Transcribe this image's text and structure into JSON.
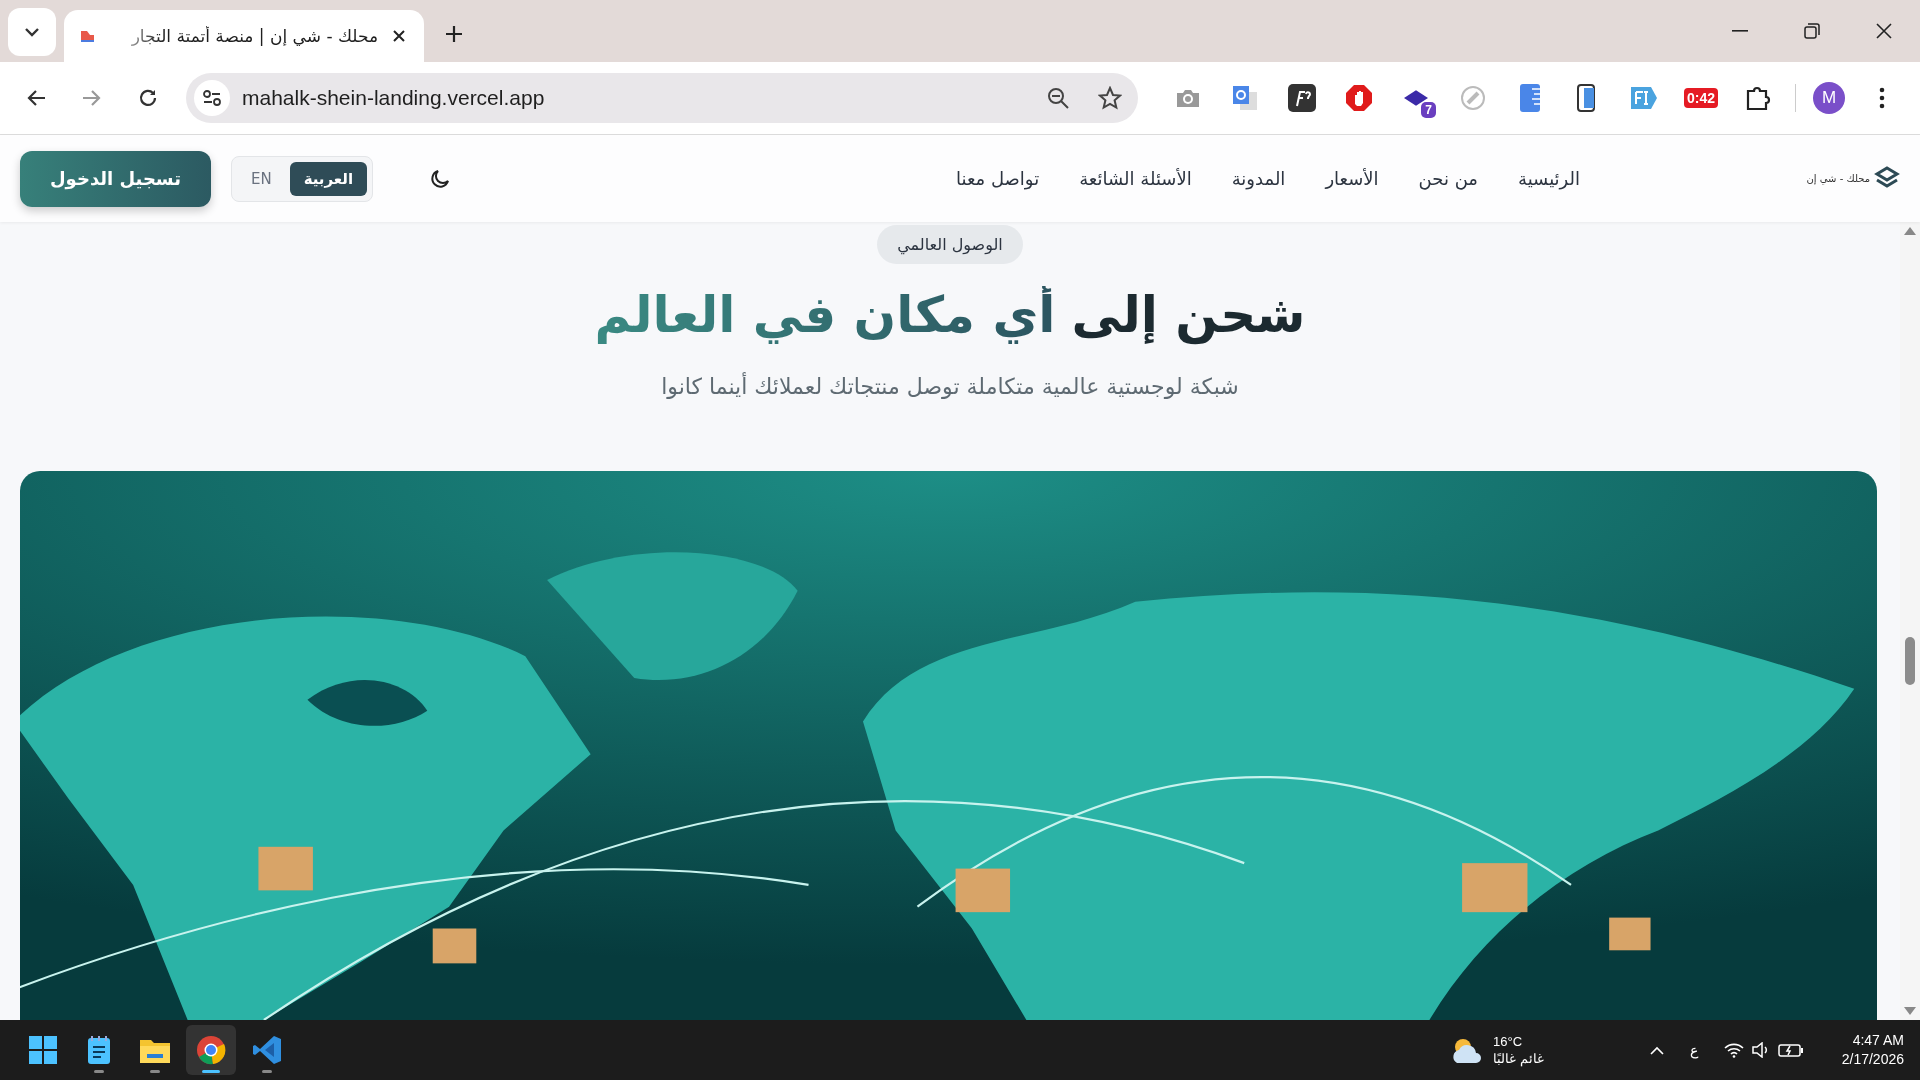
{
  "browser": {
    "tab": {
      "title": "محلك - شي إن | منصة أتمتة التجار"
    },
    "address": "mahalk-shein-landing.vercel.app",
    "extension_badge": "7",
    "extension_timer": "0:42",
    "profile_initial": "M"
  },
  "site_nav": {
    "logo_text": "محلك - شي إن",
    "links": [
      "الرئيسية",
      "من نحن",
      "الأسعار",
      "المدونة",
      "الأسئلة الشائعة",
      "تواصل معنا"
    ],
    "languages": [
      {
        "label": "العربية",
        "selected": true
      },
      {
        "label": "EN",
        "selected": false
      }
    ],
    "login_button": "تسجيل الدخول"
  },
  "hero": {
    "badge": "الوصول العالمي",
    "title_parts": [
      {
        "text": "شحن إلى",
        "kind": "plain"
      },
      {
        "text": "أي مكان في العالم",
        "kind": "accent"
      }
    ],
    "subtitle": "شبكة لوجستية عالمية متكاملة توصل منتجاتك لعملائك أينما كانوا"
  },
  "taskbar": {
    "apps": [
      {
        "kind": "start",
        "running": false,
        "selected": false
      },
      {
        "kind": "notepad",
        "running": true,
        "selected": false
      },
      {
        "kind": "files",
        "running": true,
        "selected": false
      },
      {
        "kind": "chrome",
        "running": true,
        "selected": true
      },
      {
        "kind": "code",
        "running": true,
        "selected": false
      }
    ],
    "weather": {
      "temperature": "16°C",
      "condition": "غائم غالبًا"
    },
    "input_language": "ع",
    "time": "4:47 AM",
    "date": "2/17/2026"
  }
}
